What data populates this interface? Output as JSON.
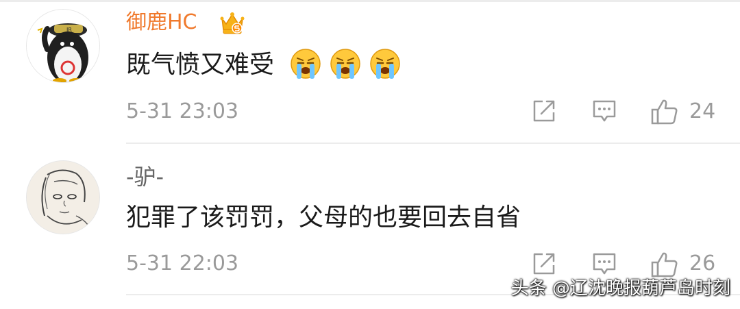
{
  "comments": [
    {
      "username": "御鹿HC",
      "text": "既气愤又难受",
      "emojis": [
        "crying-face",
        "crying-face",
        "crying-face"
      ],
      "timestamp": "5-31 23:03",
      "like_count": "24",
      "username_color": "#f07a2d"
    },
    {
      "username": "-驴-",
      "text": "犯罪了该罚罚，父母的也要回去自省",
      "timestamp": "5-31 22:03",
      "like_count": "26"
    }
  ],
  "watermark": "头条 @辽沈晚报葫芦岛时刻"
}
